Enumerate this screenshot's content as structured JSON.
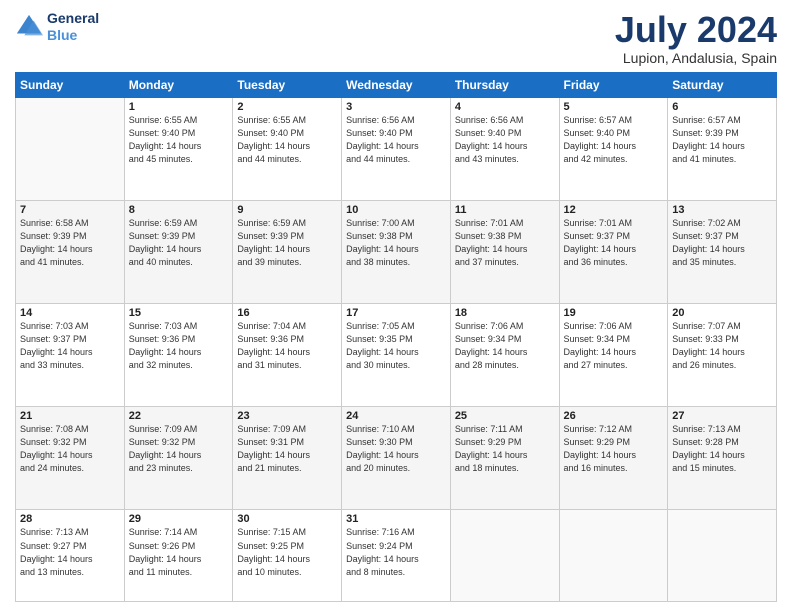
{
  "header": {
    "logo_line1": "General",
    "logo_line2": "Blue",
    "main_title": "July 2024",
    "subtitle": "Lupion, Andalusia, Spain"
  },
  "days_of_week": [
    "Sunday",
    "Monday",
    "Tuesday",
    "Wednesday",
    "Thursday",
    "Friday",
    "Saturday"
  ],
  "weeks": [
    [
      {
        "num": "",
        "info": ""
      },
      {
        "num": "1",
        "info": "Sunrise: 6:55 AM\nSunset: 9:40 PM\nDaylight: 14 hours\nand 45 minutes."
      },
      {
        "num": "2",
        "info": "Sunrise: 6:55 AM\nSunset: 9:40 PM\nDaylight: 14 hours\nand 44 minutes."
      },
      {
        "num": "3",
        "info": "Sunrise: 6:56 AM\nSunset: 9:40 PM\nDaylight: 14 hours\nand 44 minutes."
      },
      {
        "num": "4",
        "info": "Sunrise: 6:56 AM\nSunset: 9:40 PM\nDaylight: 14 hours\nand 43 minutes."
      },
      {
        "num": "5",
        "info": "Sunrise: 6:57 AM\nSunset: 9:40 PM\nDaylight: 14 hours\nand 42 minutes."
      },
      {
        "num": "6",
        "info": "Sunrise: 6:57 AM\nSunset: 9:39 PM\nDaylight: 14 hours\nand 41 minutes."
      }
    ],
    [
      {
        "num": "7",
        "info": "Sunrise: 6:58 AM\nSunset: 9:39 PM\nDaylight: 14 hours\nand 41 minutes."
      },
      {
        "num": "8",
        "info": "Sunrise: 6:59 AM\nSunset: 9:39 PM\nDaylight: 14 hours\nand 40 minutes."
      },
      {
        "num": "9",
        "info": "Sunrise: 6:59 AM\nSunset: 9:39 PM\nDaylight: 14 hours\nand 39 minutes."
      },
      {
        "num": "10",
        "info": "Sunrise: 7:00 AM\nSunset: 9:38 PM\nDaylight: 14 hours\nand 38 minutes."
      },
      {
        "num": "11",
        "info": "Sunrise: 7:01 AM\nSunset: 9:38 PM\nDaylight: 14 hours\nand 37 minutes."
      },
      {
        "num": "12",
        "info": "Sunrise: 7:01 AM\nSunset: 9:37 PM\nDaylight: 14 hours\nand 36 minutes."
      },
      {
        "num": "13",
        "info": "Sunrise: 7:02 AM\nSunset: 9:37 PM\nDaylight: 14 hours\nand 35 minutes."
      }
    ],
    [
      {
        "num": "14",
        "info": "Sunrise: 7:03 AM\nSunset: 9:37 PM\nDaylight: 14 hours\nand 33 minutes."
      },
      {
        "num": "15",
        "info": "Sunrise: 7:03 AM\nSunset: 9:36 PM\nDaylight: 14 hours\nand 32 minutes."
      },
      {
        "num": "16",
        "info": "Sunrise: 7:04 AM\nSunset: 9:36 PM\nDaylight: 14 hours\nand 31 minutes."
      },
      {
        "num": "17",
        "info": "Sunrise: 7:05 AM\nSunset: 9:35 PM\nDaylight: 14 hours\nand 30 minutes."
      },
      {
        "num": "18",
        "info": "Sunrise: 7:06 AM\nSunset: 9:34 PM\nDaylight: 14 hours\nand 28 minutes."
      },
      {
        "num": "19",
        "info": "Sunrise: 7:06 AM\nSunset: 9:34 PM\nDaylight: 14 hours\nand 27 minutes."
      },
      {
        "num": "20",
        "info": "Sunrise: 7:07 AM\nSunset: 9:33 PM\nDaylight: 14 hours\nand 26 minutes."
      }
    ],
    [
      {
        "num": "21",
        "info": "Sunrise: 7:08 AM\nSunset: 9:32 PM\nDaylight: 14 hours\nand 24 minutes."
      },
      {
        "num": "22",
        "info": "Sunrise: 7:09 AM\nSunset: 9:32 PM\nDaylight: 14 hours\nand 23 minutes."
      },
      {
        "num": "23",
        "info": "Sunrise: 7:09 AM\nSunset: 9:31 PM\nDaylight: 14 hours\nand 21 minutes."
      },
      {
        "num": "24",
        "info": "Sunrise: 7:10 AM\nSunset: 9:30 PM\nDaylight: 14 hours\nand 20 minutes."
      },
      {
        "num": "25",
        "info": "Sunrise: 7:11 AM\nSunset: 9:29 PM\nDaylight: 14 hours\nand 18 minutes."
      },
      {
        "num": "26",
        "info": "Sunrise: 7:12 AM\nSunset: 9:29 PM\nDaylight: 14 hours\nand 16 minutes."
      },
      {
        "num": "27",
        "info": "Sunrise: 7:13 AM\nSunset: 9:28 PM\nDaylight: 14 hours\nand 15 minutes."
      }
    ],
    [
      {
        "num": "28",
        "info": "Sunrise: 7:13 AM\nSunset: 9:27 PM\nDaylight: 14 hours\nand 13 minutes."
      },
      {
        "num": "29",
        "info": "Sunrise: 7:14 AM\nSunset: 9:26 PM\nDaylight: 14 hours\nand 11 minutes."
      },
      {
        "num": "30",
        "info": "Sunrise: 7:15 AM\nSunset: 9:25 PM\nDaylight: 14 hours\nand 10 minutes."
      },
      {
        "num": "31",
        "info": "Sunrise: 7:16 AM\nSunset: 9:24 PM\nDaylight: 14 hours\nand 8 minutes."
      },
      {
        "num": "",
        "info": ""
      },
      {
        "num": "",
        "info": ""
      },
      {
        "num": "",
        "info": ""
      }
    ]
  ]
}
